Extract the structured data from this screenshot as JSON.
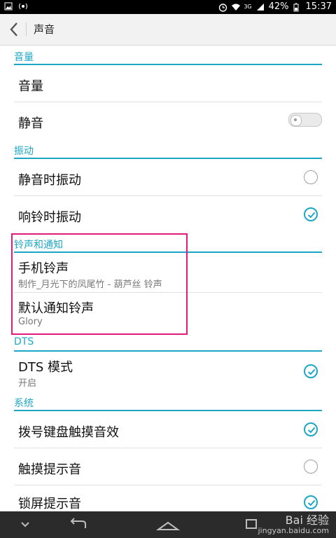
{
  "status_bar": {
    "battery": "42%",
    "time": "15:37",
    "network": "3G"
  },
  "action_bar": {
    "title": "声音"
  },
  "sections": {
    "volume_header": "音量",
    "vibration_header": "振动",
    "ringtone_header": "铃声和通知",
    "dts_header": "DTS",
    "system_header": "系统"
  },
  "rows": {
    "volume": "音量",
    "mute": "静音",
    "vibrate_on_mute": "静音时振动",
    "vibrate_on_ring": "响铃时振动",
    "phone_ringtone": "手机铃声",
    "phone_ringtone_sub": "制作_月光下的凤尾竹 - 葫芦丝 铃声",
    "notification_ringtone": "默认通知铃声",
    "notification_ringtone_sub": "Glory",
    "dts_mode": "DTS 模式",
    "dts_mode_sub": "开启",
    "dial_touch_sound": "拨号键盘触摸音效",
    "touch_sound": "触摸提示音",
    "lockscreen_sound": "锁屏提示音"
  },
  "states": {
    "mute": "off",
    "vibrate_on_mute": false,
    "vibrate_on_ring": true,
    "dts_mode": true,
    "dial_touch_sound": true,
    "touch_sound": false,
    "lockscreen_sound": true
  },
  "watermark": {
    "line1": "Bai 经验",
    "line2": "jingyan.baidu.com"
  },
  "colors": {
    "accent": "#1ea6c5",
    "highlight": "#e01b7b"
  },
  "icons": {
    "back": "chevron-left-icon",
    "nav_down": "chevron-down-icon",
    "nav_back": "back-arrow-icon",
    "nav_home": "home-icon",
    "nav_recent": "recent-apps-icon"
  }
}
